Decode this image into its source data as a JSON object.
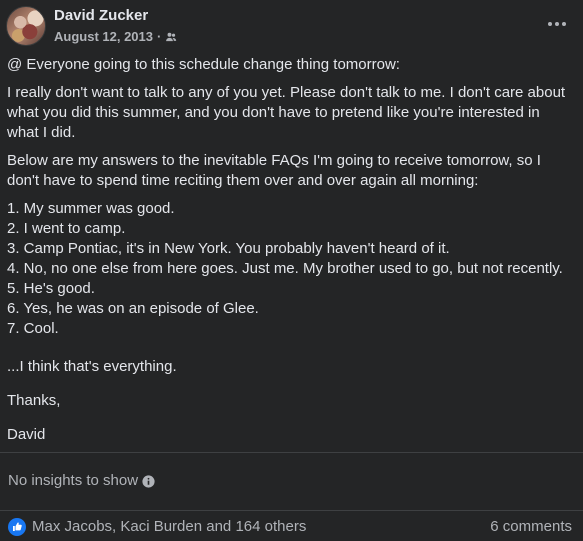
{
  "post": {
    "author": "David Zucker",
    "date": "August 12, 2013",
    "separator": "·",
    "audience_icon": "friends-icon",
    "more_icon": "more-horizontal-icon",
    "paragraphs": [
      "@ Everyone going to this schedule change thing tomorrow:",
      "I really don't want to talk to any of you yet. Please don't talk to me. I don't care about what you did this summer, and you don't have to pretend like you're interested in what I did.",
      "Below are my answers to the inevitable FAQs I'm going to receive tomorrow, so I don't have to spend time reciting them over and over again all morning:"
    ],
    "list": [
      "1. My summer was good.",
      "2. I went to camp.",
      "3. Camp Pontiac, it's in New York. You probably haven't heard of it.",
      "4. No, no one else from here goes. Just me. My brother used to go, but not recently.",
      "5. He's good.",
      "6. Yes, he was on an episode of Glee.",
      "7. Cool."
    ],
    "closing": [
      "...I think that's everything.",
      "Thanks,",
      "David"
    ]
  },
  "insights": {
    "text": "No insights to show",
    "icon": "info-icon"
  },
  "footer": {
    "reaction_icon": "like-icon",
    "reactions_text": "Max Jacobs, Kaci Burden and 164 others",
    "comments_text": "6 comments"
  },
  "colors": {
    "background": "#242526",
    "primary_text": "#e4e6eb",
    "secondary_text": "#b0b3b8",
    "like_blue": "#1877f2",
    "divider": "#3e4042"
  }
}
